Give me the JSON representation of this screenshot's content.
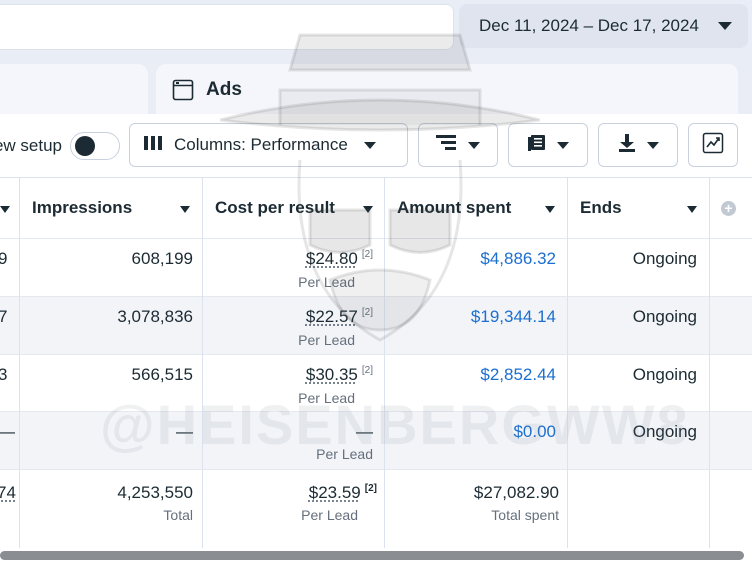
{
  "date_range": "Dec 11, 2024 – Dec 17, 2024",
  "tabs": {
    "ads": "Ads"
  },
  "toolbar": {
    "setup_label": "View setup",
    "columns_label": "Columns: Performance"
  },
  "table": {
    "headers": [
      "Impressions",
      "Cost per result",
      "Amount spent",
      "Ends"
    ],
    "rows": [
      {
        "cut": "9",
        "impressions": "608,199",
        "cost": "$24.80",
        "cost_sup": "[2]",
        "cost_sub": "Per Lead",
        "spent": "$4,886.32",
        "ends": "Ongoing"
      },
      {
        "cut": "7",
        "impressions": "3,078,836",
        "cost": "$22.57",
        "cost_sup": "[2]",
        "cost_sub": "Per Lead",
        "spent": "$19,344.14",
        "ends": "Ongoing"
      },
      {
        "cut": "3",
        "impressions": "566,515",
        "cost": "$30.35",
        "cost_sup": "[2]",
        "cost_sub": "Per Lead",
        "spent": "$2,852.44",
        "ends": "Ongoing"
      },
      {
        "cut": "—",
        "impressions": "—",
        "cost": "—",
        "cost_sup": "",
        "cost_sub": "Per Lead",
        "spent": "$0.00",
        "ends": "Ongoing"
      }
    ],
    "total": {
      "cut": "74",
      "impressions": "4,253,550",
      "impressions_sub": "Total",
      "cost": "$23.59",
      "cost_sup": "[2]",
      "cost_sub": "Per Lead",
      "spent": "$27,082.90",
      "spent_sub": "Total spent"
    }
  },
  "watermark": "@HEISENBERGWW8",
  "colors": {
    "link": "#1b6fcf",
    "background": "#e9edf6"
  }
}
